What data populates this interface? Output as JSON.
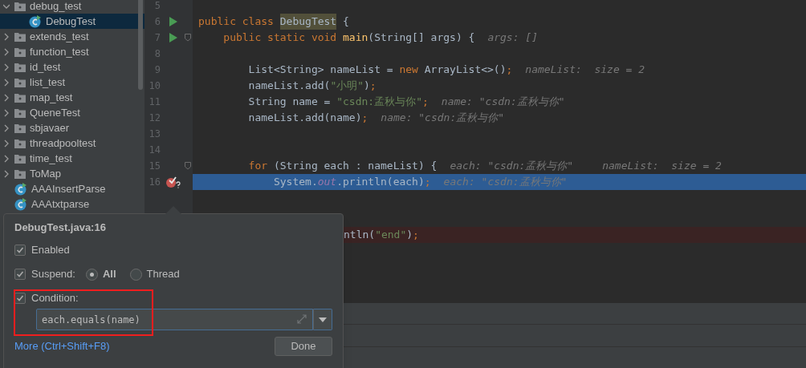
{
  "project_tree": [
    {
      "label": "debug_test",
      "kind": "folder",
      "expanded": true,
      "selected": false,
      "children": [
        {
          "label": "DebugTest",
          "kind": "class",
          "selected": true
        }
      ]
    },
    {
      "label": "extends_test",
      "kind": "folder",
      "expanded": false,
      "selected": false
    },
    {
      "label": "function_test",
      "kind": "folder",
      "expanded": false,
      "selected": false
    },
    {
      "label": "id_test",
      "kind": "folder",
      "expanded": false,
      "selected": false
    },
    {
      "label": "list_test",
      "kind": "folder",
      "expanded": false,
      "selected": false
    },
    {
      "label": "map_test",
      "kind": "folder",
      "expanded": false,
      "selected": false
    },
    {
      "label": "QueneTest",
      "kind": "folder",
      "expanded": false,
      "selected": false
    },
    {
      "label": "sbjavaer",
      "kind": "folder",
      "expanded": false,
      "selected": false
    },
    {
      "label": "threadpooltest",
      "kind": "folder",
      "expanded": false,
      "selected": false
    },
    {
      "label": "time_test",
      "kind": "folder",
      "expanded": false,
      "selected": false
    },
    {
      "label": "ToMap",
      "kind": "folder",
      "expanded": false,
      "selected": false
    },
    {
      "label": "AAAInsertParse",
      "kind": "class",
      "selected": false
    },
    {
      "label": "AAAtxtparse",
      "kind": "class",
      "selected": false
    }
  ],
  "editor_lines": [
    {
      "number": "5",
      "run": false,
      "fold": false,
      "breakpoint": false,
      "selected": false
    },
    {
      "number": "6",
      "run": true,
      "fold": false,
      "breakpoint": false,
      "selected": false,
      "tokens": [
        {
          "text": "public class ",
          "kind": "keyword"
        },
        {
          "text": "DebugTest",
          "kind": "match"
        },
        {
          "text": " {",
          "kind": "plain"
        }
      ]
    },
    {
      "number": "7",
      "run": true,
      "fold": true,
      "breakpoint": false,
      "selected": false,
      "tokens": [
        {
          "text": "    public static void ",
          "kind": "keyword"
        },
        {
          "text": "main",
          "kind": "method"
        },
        {
          "text": "(String[] args) {",
          "kind": "plain"
        }
      ],
      "hints": [
        "args: []"
      ]
    },
    {
      "number": "8",
      "run": false,
      "fold": false,
      "breakpoint": false,
      "selected": false
    },
    {
      "number": "9",
      "run": false,
      "fold": false,
      "breakpoint": false,
      "selected": false,
      "tokens": [
        {
          "text": "        List<String> nameList = ",
          "kind": "plain"
        },
        {
          "text": "new ",
          "kind": "keyword"
        },
        {
          "text": "ArrayList<>()",
          "kind": "plain"
        },
        {
          "text": ";",
          "kind": "keyword"
        }
      ],
      "hints": [
        "nameList:  size = 2"
      ]
    },
    {
      "number": "10",
      "run": false,
      "fold": false,
      "breakpoint": false,
      "selected": false,
      "tokens": [
        {
          "text": "        nameList.add(",
          "kind": "plain"
        },
        {
          "text": "\"小明\"",
          "kind": "string"
        },
        {
          "text": ")",
          "kind": "plain"
        },
        {
          "text": ";",
          "kind": "keyword"
        }
      ]
    },
    {
      "number": "11",
      "run": false,
      "fold": false,
      "breakpoint": false,
      "selected": false,
      "tokens": [
        {
          "text": "        String name = ",
          "kind": "plain"
        },
        {
          "text": "\"csdn:孟秋与你\"",
          "kind": "string"
        },
        {
          "text": ";",
          "kind": "keyword"
        }
      ],
      "hints": [
        "name: \"csdn:孟秋与你\""
      ]
    },
    {
      "number": "12",
      "run": false,
      "fold": false,
      "breakpoint": false,
      "selected": false,
      "tokens": [
        {
          "text": "        nameList.add(name)",
          "kind": "plain"
        },
        {
          "text": ";",
          "kind": "keyword"
        }
      ],
      "hints": [
        "name: \"csdn:孟秋与你\""
      ]
    },
    {
      "number": "13",
      "run": false,
      "fold": false,
      "breakpoint": false,
      "selected": false
    },
    {
      "number": "14",
      "run": false,
      "fold": false,
      "breakpoint": false,
      "selected": false
    },
    {
      "number": "15",
      "run": false,
      "fold": true,
      "breakpoint": false,
      "selected": false,
      "tokens": [
        {
          "text": "        for ",
          "kind": "keyword"
        },
        {
          "text": "(String each : nameList) {",
          "kind": "plain"
        }
      ],
      "hints": [
        "each: \"csdn:孟秋与你\"",
        "nameList:  size = 2"
      ]
    },
    {
      "number": "16",
      "run": false,
      "fold": false,
      "breakpoint": true,
      "selected": true,
      "tokens": [
        {
          "text": "            System.",
          "kind": "plain"
        },
        {
          "text": "out",
          "kind": "field"
        },
        {
          "text": ".println(each)",
          "kind": "plain"
        },
        {
          "text": ";",
          "kind": "keyword"
        }
      ],
      "hints": [
        "each: \"csdn:孟秋与你\""
      ]
    }
  ],
  "partial_line": {
    "breakpoint": true,
    "tokens": [
      {
        "text": "ntln(",
        "kind": "plain"
      },
      {
        "text": "\"end\"",
        "kind": "string"
      },
      {
        "text": ")",
        "kind": "plain"
      },
      {
        "text": ";",
        "kind": "keyword"
      }
    ]
  },
  "breakpoint_popup": {
    "title": "DebugTest.java:16",
    "enabled": {
      "label": "Enabled",
      "checked": true
    },
    "suspend": {
      "label": "Suspend:",
      "checked": true,
      "options": [
        {
          "label": "All",
          "selected": true
        },
        {
          "label": "Thread",
          "selected": false
        }
      ]
    },
    "condition": {
      "label": "Condition:",
      "checked": true,
      "value": "each.equals(name)"
    },
    "more_link": "More (Ctrl+Shift+F8)",
    "done_button": "Done"
  }
}
